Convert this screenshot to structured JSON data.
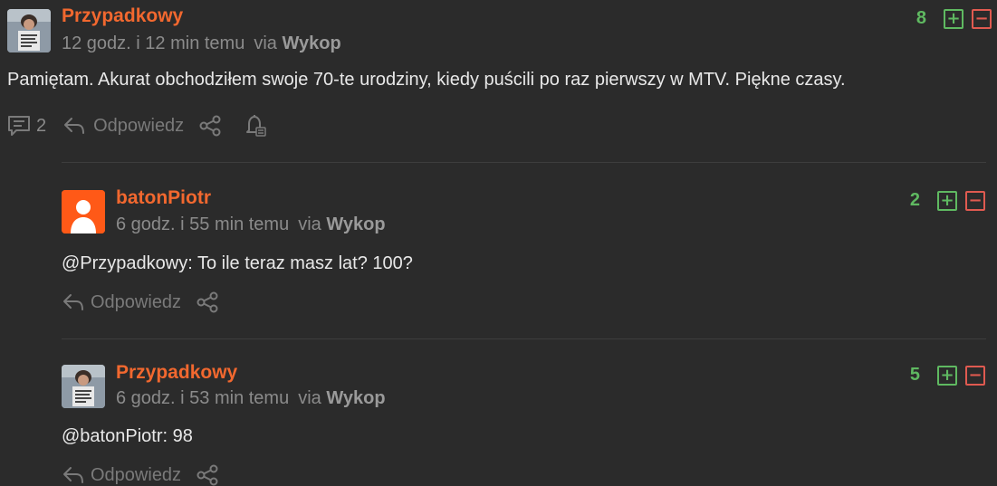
{
  "comments": [
    {
      "author": "Przypadkowy",
      "time": "12 godz. i 12 min temu",
      "via_prefix": "via",
      "via_source": "Wykop",
      "score": "8",
      "text": "Pamiętam. Akurat obchodziłem swoje 70-te urodziny, kiedy puścili po raz pierwszy w MTV. Piękne czasy.",
      "reply_count": "2",
      "reply_label": "Odpowiedz",
      "avatar": "photo"
    },
    {
      "author": "batonPiotr",
      "time": "6 godz. i 55 min temu",
      "via_prefix": "via",
      "via_source": "Wykop",
      "score": "2",
      "text": "@Przypadkowy: To ile teraz masz lat? 100?",
      "reply_label": "Odpowiedz",
      "avatar": "default"
    },
    {
      "author": "Przypadkowy",
      "time": "6 godz. i 53 min temu",
      "via_prefix": "via",
      "via_source": "Wykop",
      "score": "5",
      "text": "@batonPiotr: 98",
      "reply_label": "Odpowiedz",
      "avatar": "photo"
    }
  ],
  "icons": {
    "plus": "+",
    "minus": "−"
  },
  "colors": {
    "author": "#f2682f",
    "upvote": "#5fb961",
    "downvote": "#e05a50",
    "background": "#2b2b2b"
  }
}
